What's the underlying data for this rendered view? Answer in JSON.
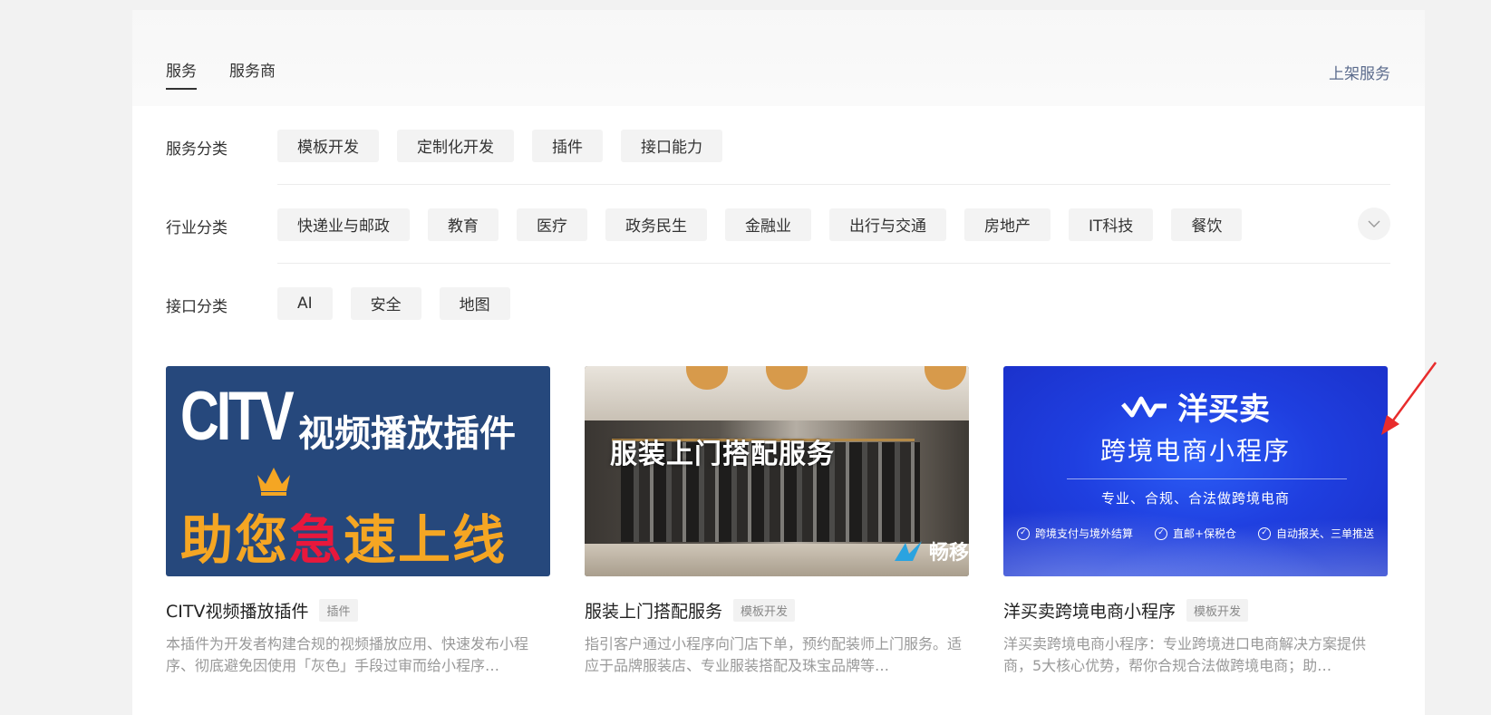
{
  "header": {
    "tabs": [
      {
        "label": "服务",
        "active": true
      },
      {
        "label": "服务商",
        "active": false
      }
    ],
    "list_service_link": "上架服务"
  },
  "filters": {
    "service_category": {
      "label": "服务分类",
      "options": [
        "模板开发",
        "定制化开发",
        "插件",
        "接口能力"
      ]
    },
    "industry_category": {
      "label": "行业分类",
      "options": [
        "快递业与邮政",
        "教育",
        "医疗",
        "政务民生",
        "金融业",
        "出行与交通",
        "房地产",
        "IT科技",
        "餐饮"
      ],
      "expand_icon": "chevron-down-icon"
    },
    "api_category": {
      "label": "接口分类",
      "options": [
        "AI",
        "安全",
        "地图"
      ]
    }
  },
  "cards": [
    {
      "title": "CITV视频播放插件",
      "tag": "插件",
      "description": "本插件为开发者构建合规的视频播放应用、快速发布小程序、彻底避免因使用「灰色」手段过审而给小程序…",
      "image": {
        "big": "CITV",
        "sub": "视频播放插件",
        "slogan_a": "助您",
        "slogan_red": "急",
        "slogan_b": "速上线",
        "colors": {
          "bg": "#26487c",
          "accent": "#f5a623",
          "red": "#e8183c"
        }
      }
    },
    {
      "title": "服装上门搭配服务",
      "tag": "模板开发",
      "description": "指引客户通过小程序向门店下单，预约配装师上门服务。适应于品牌服装店、专业服装搭配及珠宝品牌等…",
      "image": {
        "caption": "服装上门搭配服务",
        "brand": "畅移"
      }
    },
    {
      "title": "洋买卖跨境电商小程序",
      "tag": "模板开发",
      "description": "洋买卖跨境电商小程序：专业跨境进口电商解决方案提供商，5大核心优势，帮你合规合法做跨境电商；助…",
      "image": {
        "logo_text": "洋买卖",
        "headline": "跨境电商小程序",
        "tagline": "专业、合规、合法做跨境电商",
        "features": [
          "跨境支付与境外结算",
          "直邮+保税仓",
          "自动报关、三单推送"
        ],
        "colors": {
          "bg": "#1f3fe0"
        }
      }
    }
  ],
  "annotation": {
    "color": "#e82c2c"
  }
}
